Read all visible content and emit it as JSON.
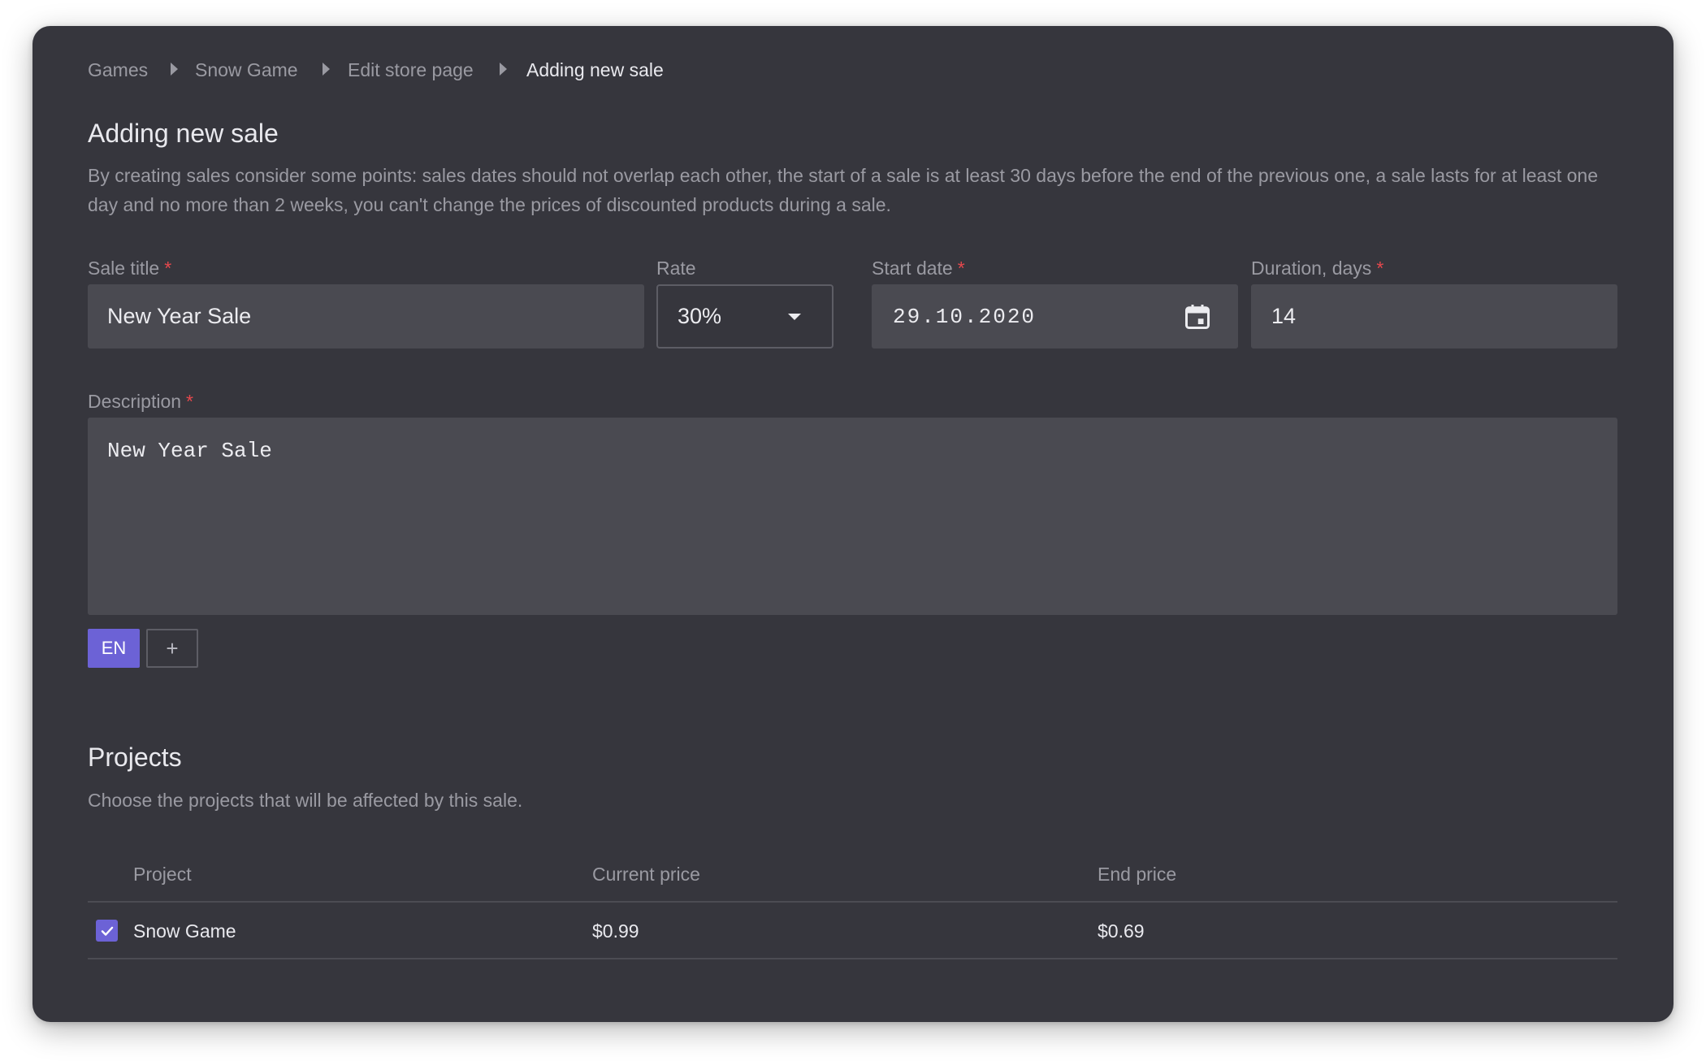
{
  "breadcrumb": {
    "items": [
      "Games",
      "Snow Game",
      "Edit store page"
    ],
    "current": "Adding new sale"
  },
  "page": {
    "title": "Adding new sale",
    "description": "By creating sales consider some points: sales dates should not overlap each other, the start of a sale is at least 30 days before the end of the previous one, a sale lasts for at least one day and no more than 2 weeks, you can't change the prices of discounted products during a sale."
  },
  "form": {
    "sale_title": {
      "label": "Sale title",
      "required_mark": "*",
      "value": "New Year Sale"
    },
    "rate": {
      "label": "Rate",
      "value": "30%"
    },
    "start_date": {
      "label": "Start date",
      "required_mark": "*",
      "value": "29.10.2020"
    },
    "duration": {
      "label": "Duration, days",
      "required_mark": "*",
      "value": "14"
    },
    "description": {
      "label": "Description",
      "required_mark": "*",
      "value": "New Year Sale"
    },
    "language_tab": "EN",
    "add_language": "+"
  },
  "projects": {
    "title": "Projects",
    "subtitle": "Choose the projects that will be affected by this sale.",
    "columns": [
      "Project",
      "Current price",
      "End price"
    ],
    "rows": [
      {
        "name": "Snow Game",
        "current_price": "$0.99",
        "end_price": "$0.69",
        "checked": true
      }
    ]
  },
  "colors": {
    "background": "#36363d",
    "field": "#4a4a51",
    "accent": "#6c62d6",
    "required": "#e5484d"
  },
  "icons": {
    "breadcrumb_separator": "caret-right-icon",
    "rate_dropdown": "caret-down-icon",
    "date_picker": "calendar-icon",
    "row_checkbox": "check-icon"
  }
}
